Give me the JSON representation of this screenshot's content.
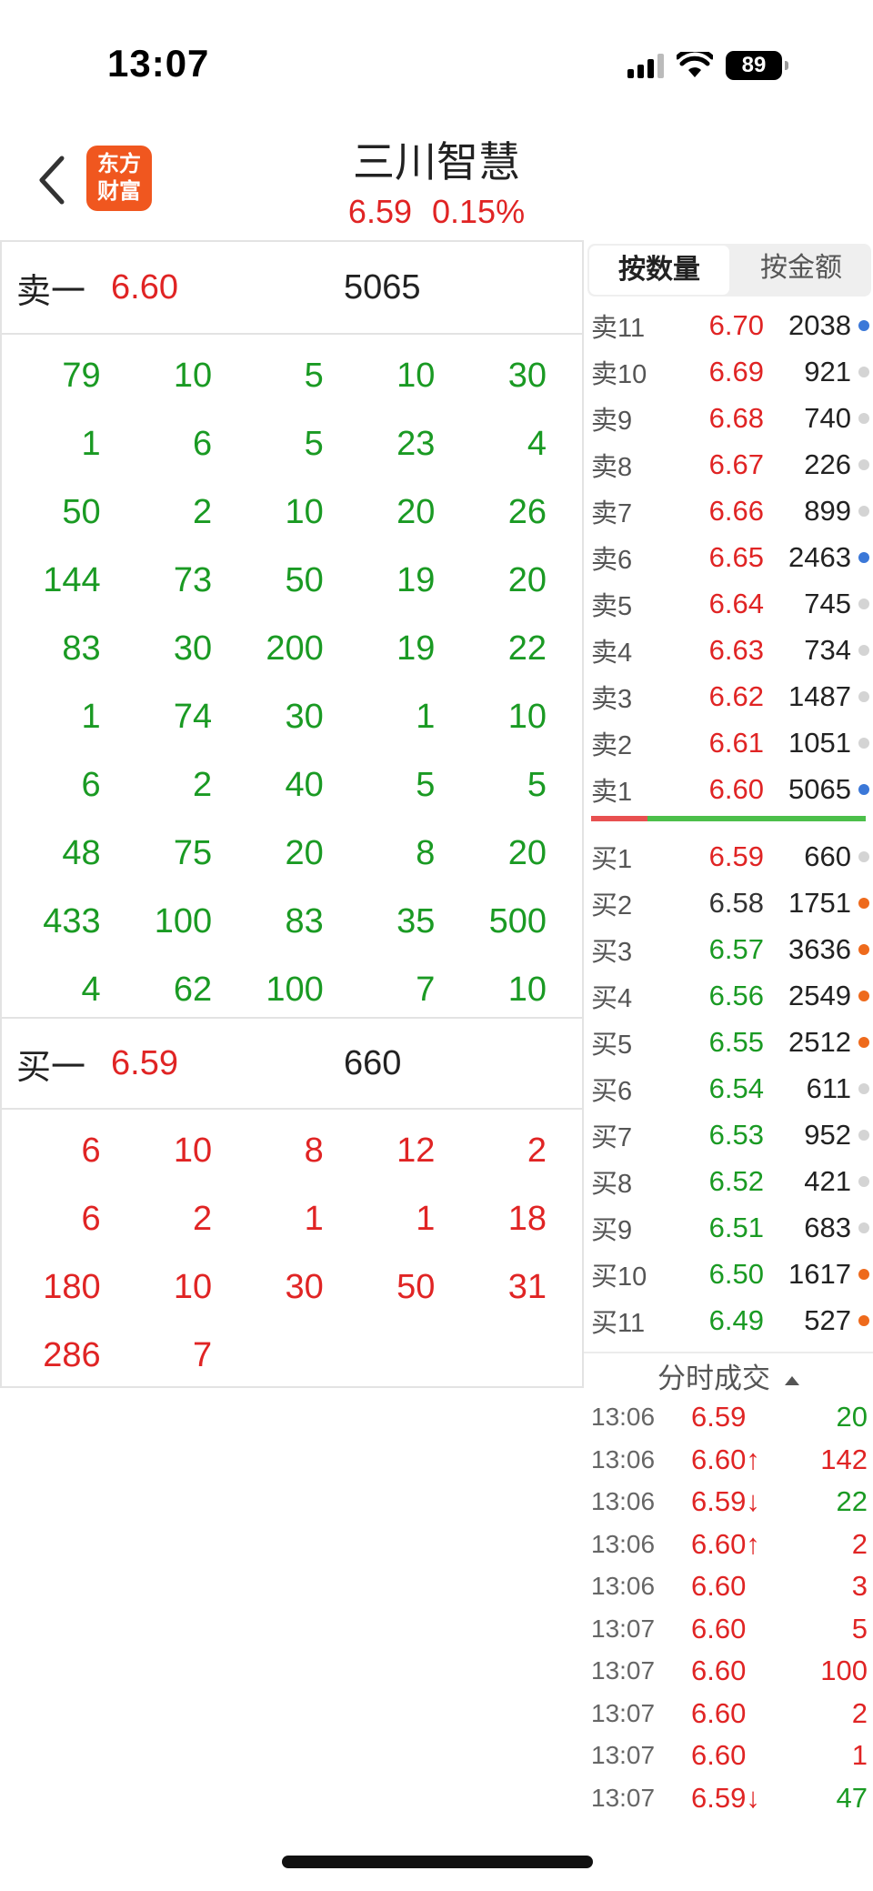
{
  "status_bar": {
    "time": "13:07",
    "battery": "89"
  },
  "header": {
    "logo_line1": "东方",
    "logo_line2": "财富",
    "title": "三川智慧",
    "price": "6.59",
    "change_pct": "0.15%"
  },
  "left": {
    "sell_label": "卖一",
    "sell_price": "6.60",
    "sell_volume": "5065",
    "sell_orders": [
      "79",
      "10",
      "5",
      "10",
      "30",
      "1",
      "6",
      "5",
      "23",
      "4",
      "50",
      "2",
      "10",
      "20",
      "26",
      "144",
      "73",
      "50",
      "19",
      "20",
      "83",
      "30",
      "200",
      "19",
      "22",
      "1",
      "74",
      "30",
      "1",
      "10",
      "6",
      "2",
      "40",
      "5",
      "5",
      "48",
      "75",
      "20",
      "8",
      "20",
      "433",
      "100",
      "83",
      "35",
      "500",
      "4",
      "62",
      "100",
      "7",
      "10"
    ],
    "buy_label": "买一",
    "buy_price": "6.59",
    "buy_volume": "660",
    "buy_orders": [
      "6",
      "10",
      "8",
      "12",
      "2",
      "6",
      "2",
      "1",
      "1",
      "18",
      "180",
      "10",
      "30",
      "50",
      "31",
      "286",
      "7"
    ]
  },
  "right": {
    "tabs": [
      "按数量",
      "按金额"
    ],
    "sell_levels": [
      {
        "label": "卖11",
        "price": "6.70",
        "volume": "2038",
        "price_color": "#e02424",
        "dot": "#3b78d8"
      },
      {
        "label": "卖10",
        "price": "6.69",
        "volume": "921",
        "price_color": "#e02424",
        "dot": "#d4d4d4"
      },
      {
        "label": "卖9",
        "price": "6.68",
        "volume": "740",
        "price_color": "#e02424",
        "dot": "#d4d4d4"
      },
      {
        "label": "卖8",
        "price": "6.67",
        "volume": "226",
        "price_color": "#e02424",
        "dot": "#d4d4d4"
      },
      {
        "label": "卖7",
        "price": "6.66",
        "volume": "899",
        "price_color": "#e02424",
        "dot": "#d4d4d4"
      },
      {
        "label": "卖6",
        "price": "6.65",
        "volume": "2463",
        "price_color": "#e02424",
        "dot": "#3b78d8"
      },
      {
        "label": "卖5",
        "price": "6.64",
        "volume": "745",
        "price_color": "#e02424",
        "dot": "#d4d4d4"
      },
      {
        "label": "卖4",
        "price": "6.63",
        "volume": "734",
        "price_color": "#e02424",
        "dot": "#d4d4d4"
      },
      {
        "label": "卖3",
        "price": "6.62",
        "volume": "1487",
        "price_color": "#e02424",
        "dot": "#d4d4d4"
      },
      {
        "label": "卖2",
        "price": "6.61",
        "volume": "1051",
        "price_color": "#e02424",
        "dot": "#d4d4d4"
      },
      {
        "label": "卖1",
        "price": "6.60",
        "volume": "5065",
        "price_color": "#e02424",
        "dot": "#3b78d8"
      }
    ],
    "buy_levels": [
      {
        "label": "买1",
        "price": "6.59",
        "volume": "660",
        "price_color": "#e02424",
        "dot": "#d4d4d4"
      },
      {
        "label": "买2",
        "price": "6.58",
        "volume": "1751",
        "price_color": "#333333",
        "dot": "#ee6a1c"
      },
      {
        "label": "买3",
        "price": "6.57",
        "volume": "3636",
        "price_color": "#1a9a23",
        "dot": "#ee6a1c"
      },
      {
        "label": "买4",
        "price": "6.56",
        "volume": "2549",
        "price_color": "#1a9a23",
        "dot": "#ee6a1c"
      },
      {
        "label": "买5",
        "price": "6.55",
        "volume": "2512",
        "price_color": "#1a9a23",
        "dot": "#ee6a1c"
      },
      {
        "label": "买6",
        "price": "6.54",
        "volume": "611",
        "price_color": "#1a9a23",
        "dot": "#d4d4d4"
      },
      {
        "label": "买7",
        "price": "6.53",
        "volume": "952",
        "price_color": "#1a9a23",
        "dot": "#d4d4d4"
      },
      {
        "label": "买8",
        "price": "6.52",
        "volume": "421",
        "price_color": "#1a9a23",
        "dot": "#d4d4d4"
      },
      {
        "label": "买9",
        "price": "6.51",
        "volume": "683",
        "price_color": "#1a9a23",
        "dot": "#d4d4d4"
      },
      {
        "label": "买10",
        "price": "6.50",
        "volume": "1617",
        "price_color": "#1a9a23",
        "dot": "#ee6a1c"
      },
      {
        "label": "买11",
        "price": "6.49",
        "volume": "527",
        "price_color": "#1a9a23",
        "dot": "#ee6a1c"
      }
    ],
    "trades_title": "分时成交",
    "trades": [
      {
        "time": "13:06",
        "price": "6.59",
        "volume": "20",
        "price_color": "#e02424",
        "vol_color": "#1a9a23"
      },
      {
        "time": "13:06",
        "price": "6.60↑",
        "volume": "142",
        "price_color": "#e02424",
        "vol_color": "#e02424"
      },
      {
        "time": "13:06",
        "price": "6.59↓",
        "volume": "22",
        "price_color": "#e02424",
        "vol_color": "#1a9a23"
      },
      {
        "time": "13:06",
        "price": "6.60↑",
        "volume": "2",
        "price_color": "#e02424",
        "vol_color": "#e02424"
      },
      {
        "time": "13:06",
        "price": "6.60",
        "volume": "3",
        "price_color": "#e02424",
        "vol_color": "#e02424"
      },
      {
        "time": "13:07",
        "price": "6.60",
        "volume": "5",
        "price_color": "#e02424",
        "vol_color": "#e02424"
      },
      {
        "time": "13:07",
        "price": "6.60",
        "volume": "100",
        "price_color": "#e02424",
        "vol_color": "#e02424"
      },
      {
        "time": "13:07",
        "price": "6.60",
        "volume": "2",
        "price_color": "#e02424",
        "vol_color": "#e02424"
      },
      {
        "time": "13:07",
        "price": "6.60",
        "volume": "1",
        "price_color": "#e02424",
        "vol_color": "#e02424"
      },
      {
        "time": "13:07",
        "price": "6.59↓",
        "volume": "47",
        "price_color": "#e02424",
        "vol_color": "#1a9a23"
      }
    ]
  }
}
